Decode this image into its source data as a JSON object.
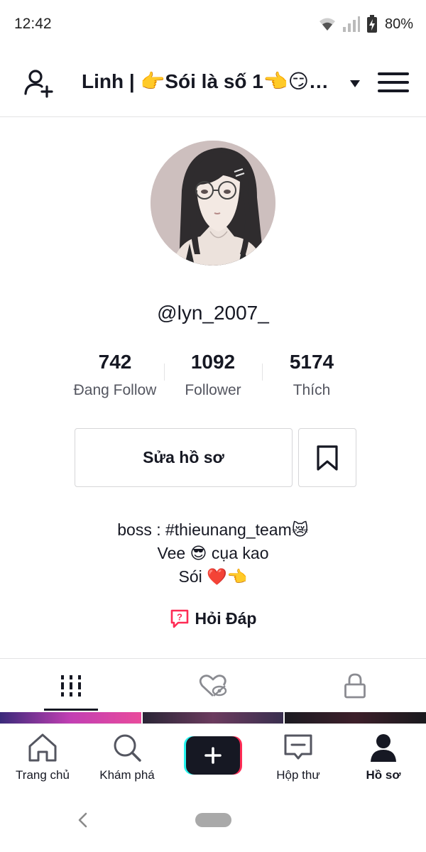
{
  "status_bar": {
    "time": "12:42",
    "battery": "80%"
  },
  "header": {
    "title": "Linh | 👉Sói là số 1👈😏…",
    "icons": [
      "add-user-icon",
      "caret-down-icon",
      "menu-icon"
    ]
  },
  "profile": {
    "username": "@lyn_2007_",
    "stats": [
      {
        "value": "742",
        "label": "Đang Follow"
      },
      {
        "value": "1092",
        "label": "Follower"
      },
      {
        "value": "5174",
        "label": "Thích"
      }
    ],
    "edit_label": "Sửa hồ sơ",
    "bio": [
      "boss : #thieunang_team😿",
      "Vee 😎 cụa kao",
      "Sói ❤️👈"
    ],
    "qa_label": "Hỏi Đáp"
  },
  "tabs": [
    "videos-grid-icon",
    "liked-hidden-icon",
    "lock-icon"
  ],
  "bottom_nav": {
    "items": [
      {
        "label": "Trang chủ",
        "icon": "home-icon"
      },
      {
        "label": "Khám phá",
        "icon": "search-icon"
      },
      {
        "label": "Hộp thư",
        "icon": "inbox-icon"
      },
      {
        "label": "Hồ sơ",
        "icon": "profile-icon"
      }
    ]
  },
  "colors": {
    "text": "#161823",
    "secondary": "#545660",
    "accent_red": "#fe2c55",
    "accent_cyan": "#25f4ee",
    "divider": "#e3e3e4"
  }
}
